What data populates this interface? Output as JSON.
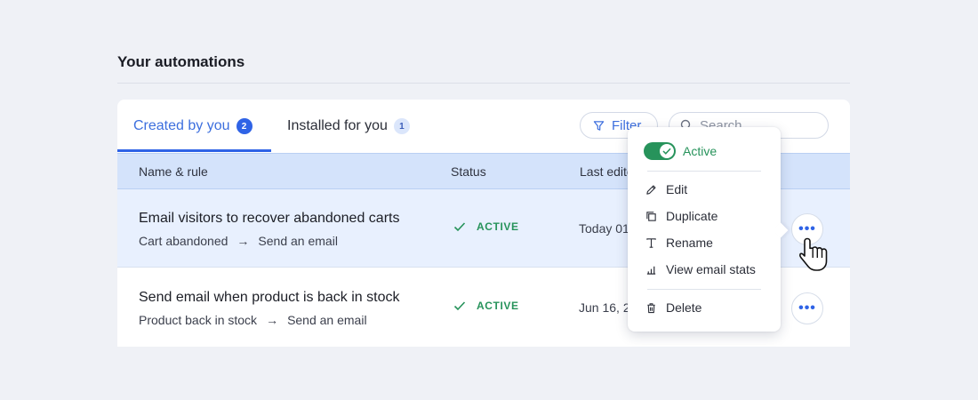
{
  "section": {
    "title": "Your automations"
  },
  "tabs": [
    {
      "label": "Created by you",
      "count": "2"
    },
    {
      "label": "Installed for you",
      "count": "1"
    }
  ],
  "toolbar": {
    "filter_label": "Filter",
    "search_placeholder": "Search"
  },
  "table": {
    "headers": {
      "name": "Name & rule",
      "status": "Status",
      "last_edited": "Last edite"
    },
    "rows": [
      {
        "title": "Email visitors to recover abandoned carts",
        "trigger": "Cart abandoned",
        "arrow": "→",
        "action": "Send an email",
        "status": "ACTIVE",
        "date": "Today 01"
      },
      {
        "title": "Send email when product is back in stock",
        "trigger": "Product back in stock",
        "arrow": "→",
        "action": "Send an email",
        "status": "ACTIVE",
        "date": "Jun 16, 2"
      }
    ],
    "more_label": "•••"
  },
  "menu": {
    "toggle_label": "Active",
    "toggle_on": true,
    "items": [
      {
        "label": "Edit",
        "icon": "pencil-icon"
      },
      {
        "label": "Duplicate",
        "icon": "duplicate-icon"
      },
      {
        "label": "Rename",
        "icon": "text-icon"
      },
      {
        "label": "View email stats",
        "icon": "stats-icon"
      },
      {
        "label": "Delete",
        "icon": "trash-icon"
      }
    ]
  },
  "colors": {
    "accent": "#2f63e6",
    "active_green": "#27935b",
    "header_bg": "#d4e3fb",
    "selected_row_bg": "#e8f0fe",
    "page_bg": "#eff1f6"
  }
}
